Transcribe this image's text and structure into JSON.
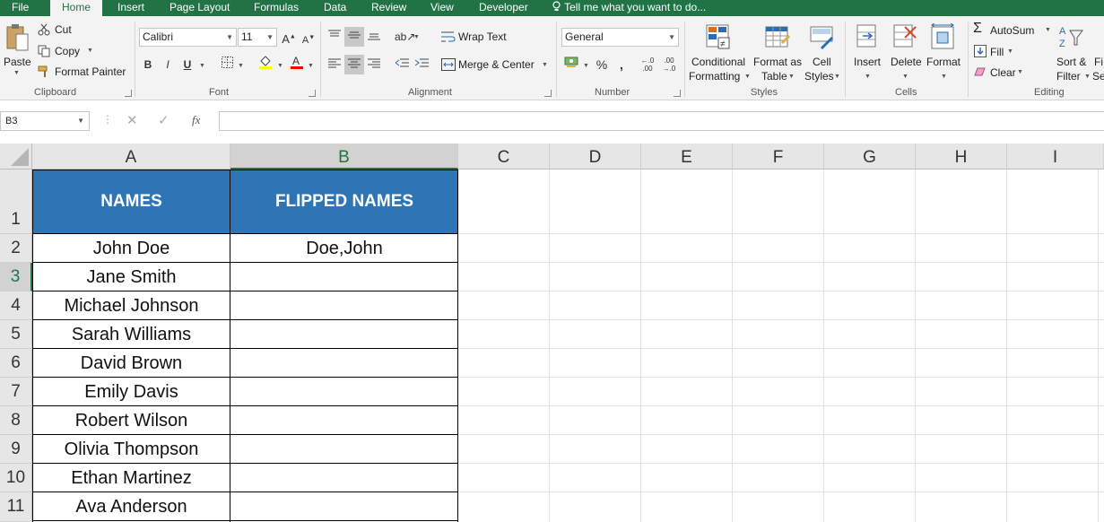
{
  "ribbon_tabs": [
    "File",
    "Home",
    "Insert",
    "Page Layout",
    "Formulas",
    "Data",
    "Review",
    "View",
    "Developer"
  ],
  "active_tab": "Home",
  "tell_me": "Tell me what you want to do...",
  "clipboard": {
    "paste": "Paste",
    "cut": "Cut",
    "copy": "Copy",
    "format_painter": "Format Painter",
    "label": "Clipboard"
  },
  "font": {
    "name": "Calibri",
    "size": "11",
    "bold": "B",
    "italic": "I",
    "underline": "U",
    "label": "Font"
  },
  "alignment": {
    "wrap_text": "Wrap Text",
    "merge_center": "Merge & Center",
    "label": "Alignment"
  },
  "number": {
    "format": "General",
    "percent": "%",
    "comma": ",",
    "label": "Number"
  },
  "styles": {
    "conditional": "Conditional",
    "formatting": "Formatting",
    "format_as": "Format as",
    "table": "Table",
    "cell": "Cell",
    "cell_styles": "Styles",
    "label": "Styles"
  },
  "cells": {
    "insert": "Insert",
    "delete": "Delete",
    "format": "Format",
    "label": "Cells"
  },
  "editing": {
    "autosum": "AutoSum",
    "fill": "Fill",
    "clear": "Clear",
    "sort": "Sort &",
    "filter": "Filter",
    "find": "Fi",
    "select": "Se",
    "label": "Editing"
  },
  "name_box": "B3",
  "formula_bar": {
    "fx": "fx",
    "value": ""
  },
  "columns": [
    "A",
    "B",
    "C",
    "D",
    "E",
    "F",
    "G",
    "H",
    "I"
  ],
  "rows": [
    "1",
    "2",
    "3",
    "4",
    "5",
    "6",
    "7",
    "8",
    "9",
    "10",
    "11"
  ],
  "table": {
    "header_a": "NAMES",
    "header_b": "FLIPPED NAMES",
    "names": [
      "John Doe",
      "Jane Smith",
      "Michael Johnson",
      "Sarah Williams",
      "David Brown",
      "Emily Davis",
      "Robert Wilson",
      "Olivia Thompson",
      "Ethan Martinez",
      "Ava Anderson"
    ],
    "flipped": [
      "Doe,John",
      "",
      "",
      "",
      "",
      "",
      "",
      "",
      "",
      ""
    ]
  },
  "colors": {
    "excel_green": "#217346",
    "header_blue": "#2e75b6"
  }
}
